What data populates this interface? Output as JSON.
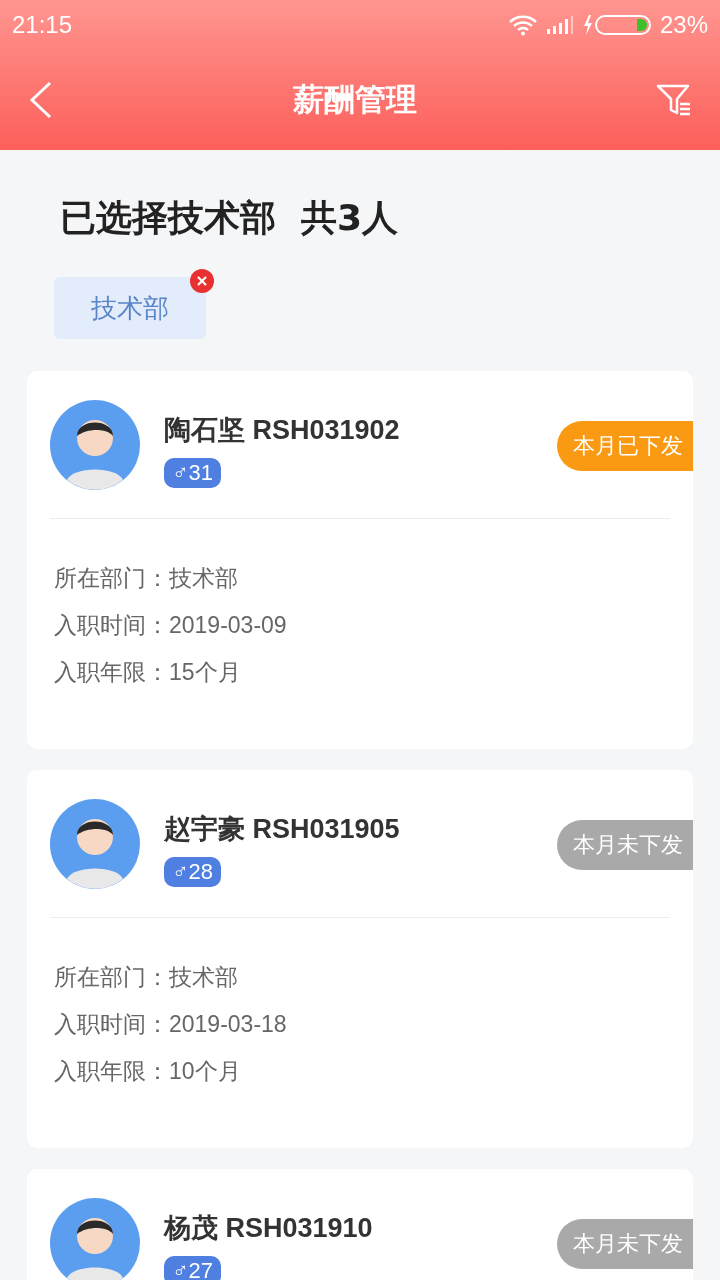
{
  "status_bar": {
    "time": "21:15",
    "battery": "23%"
  },
  "header": {
    "title": "薪酬管理"
  },
  "summary": {
    "title": "已选择技术部  共3人"
  },
  "filters": [
    {
      "label": "技术部"
    }
  ],
  "employees": [
    {
      "name": "陶石坚 RSH031902",
      "gender": "♂",
      "age": "31",
      "status": {
        "kind": "issued",
        "label": "本月已下发"
      },
      "fields": [
        {
          "label": "所在部门：",
          "value": "技术部"
        },
        {
          "label": "入职时间：",
          "value": "2019-03-09"
        },
        {
          "label": "入职年限：",
          "value": "15个月"
        }
      ]
    },
    {
      "name": "赵宇豪 RSH031905",
      "gender": "♂",
      "age": "28",
      "status": {
        "kind": "pending",
        "label": "本月未下发"
      },
      "fields": [
        {
          "label": "所在部门：",
          "value": "技术部"
        },
        {
          "label": "入职时间：",
          "value": "2019-03-18"
        },
        {
          "label": "入职年限：",
          "value": "10个月"
        }
      ]
    },
    {
      "name": "杨茂 RSH031910",
      "gender": "♂",
      "age": "27",
      "status": {
        "kind": "pending",
        "label": "本月未下发"
      }
    }
  ]
}
